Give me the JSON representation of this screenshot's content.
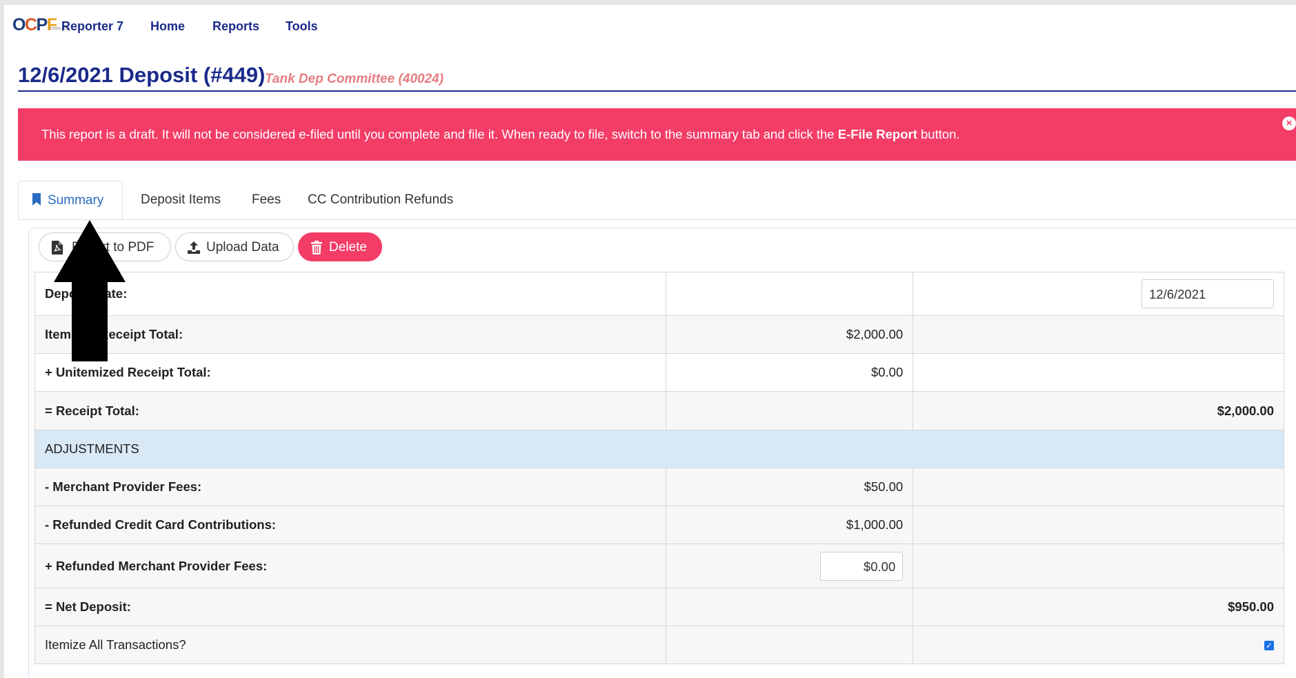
{
  "nav": {
    "logo_text": "OCPF",
    "logo_sub": "mass.gov",
    "brand": "Reporter 7",
    "links": [
      "Home",
      "Reports",
      "Tools"
    ]
  },
  "header": {
    "title": "12/6/2021 Deposit (#449)",
    "subtitle": "Tank Dep Committee (40024)"
  },
  "alert": {
    "text_before": "This report is a draft. It will not be considered e-filed until you complete and file it. When ready to file, switch to the summary tab and click the ",
    "bold": "E-File Report",
    "text_after": " button.",
    "close": "×"
  },
  "tabs": [
    "Summary",
    "Deposit Items",
    "Fees",
    "CC Contribution Refunds"
  ],
  "toolbar": {
    "export_label": "Export to PDF",
    "upload_label": "Upload Data",
    "delete_label": "Delete"
  },
  "summary": {
    "deposit_date_label": "Deposit Date:",
    "deposit_date_value": "12/6/2021",
    "itemized_label": "Itemized Receipt Total:",
    "itemized_value": "$2,000.00",
    "unitemized_label": "+ Unitemized Receipt Total:",
    "unitemized_value": "$0.00",
    "receipt_total_label": "= Receipt Total:",
    "receipt_total_value": "$2,000.00",
    "adjustments_label": "ADJUSTMENTS",
    "merchant_fees_label": "- Merchant Provider Fees:",
    "merchant_fees_value": "$50.00",
    "refunded_cc_label": "- Refunded Credit Card Contributions:",
    "refunded_cc_value": "$1,000.00",
    "refunded_fees_label": "+ Refunded Merchant Provider Fees:",
    "refunded_fees_value": "$0.00",
    "net_deposit_label": "= Net Deposit:",
    "net_deposit_value": "$950.00",
    "itemize_all_label": "Itemize All Transactions?",
    "itemize_all_checked": true
  },
  "colors": {
    "navy": "#1a2a8a",
    "alert": "#f33c66",
    "tab_active": "#2a6bbf",
    "adjustments_bg": "#d9e8f5"
  }
}
